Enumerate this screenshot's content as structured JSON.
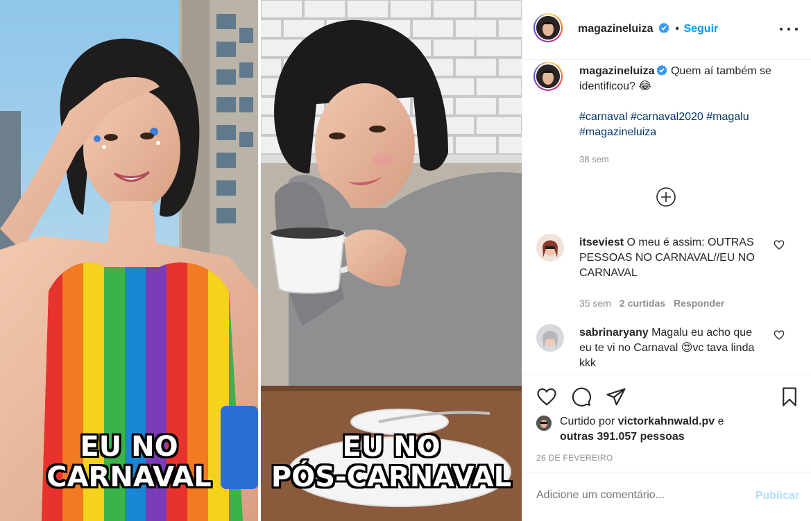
{
  "post": {
    "left_caption_line1": "EU NO",
    "left_caption_line2": "CARNAVAL",
    "right_caption_line1": "EU NO",
    "right_caption_line2": "PÓS-CARNAVAL"
  },
  "header": {
    "username": "magazineluiza",
    "separator": "•",
    "follow_label": "Seguir"
  },
  "caption": {
    "username": "magazineluiza",
    "text": "Quem aí também se identificou? 😂",
    "hashtags": "#carnaval #carnaval2020 #magalu #magazineluiza",
    "time": "38 sem"
  },
  "comments": [
    {
      "username": "itseviest",
      "text": "O meu é assim: OUTRAS PESSOAS NO CARNAVAL//EU NO CARNAVAL",
      "time": "35 sem",
      "likes": "2 curtidas",
      "reply": "Responder"
    },
    {
      "username": "sabrinaryany",
      "text": "Magalu eu acho que eu te vi no Carnaval 😍vc tava linda kkk"
    }
  ],
  "likes": {
    "prefix": "Curtido por ",
    "user": "victorkahnwald.pv",
    "suffix": " e",
    "others": "outras 391.057 pessoas"
  },
  "date": "26 DE FEVEREIRO",
  "add_comment": {
    "placeholder": "Adicione um comentário...",
    "publish_label": "Publicar"
  },
  "colors": {
    "link_blue": "#0095f6",
    "hashtag": "#00376b",
    "muted": "#8e8e8e",
    "publish_disabled": "#b2dffc"
  },
  "icons": [
    "verified-badge-icon",
    "more-options-icon",
    "load-more-icon",
    "heart-icon",
    "comment-icon",
    "share-icon",
    "bookmark-icon"
  ]
}
